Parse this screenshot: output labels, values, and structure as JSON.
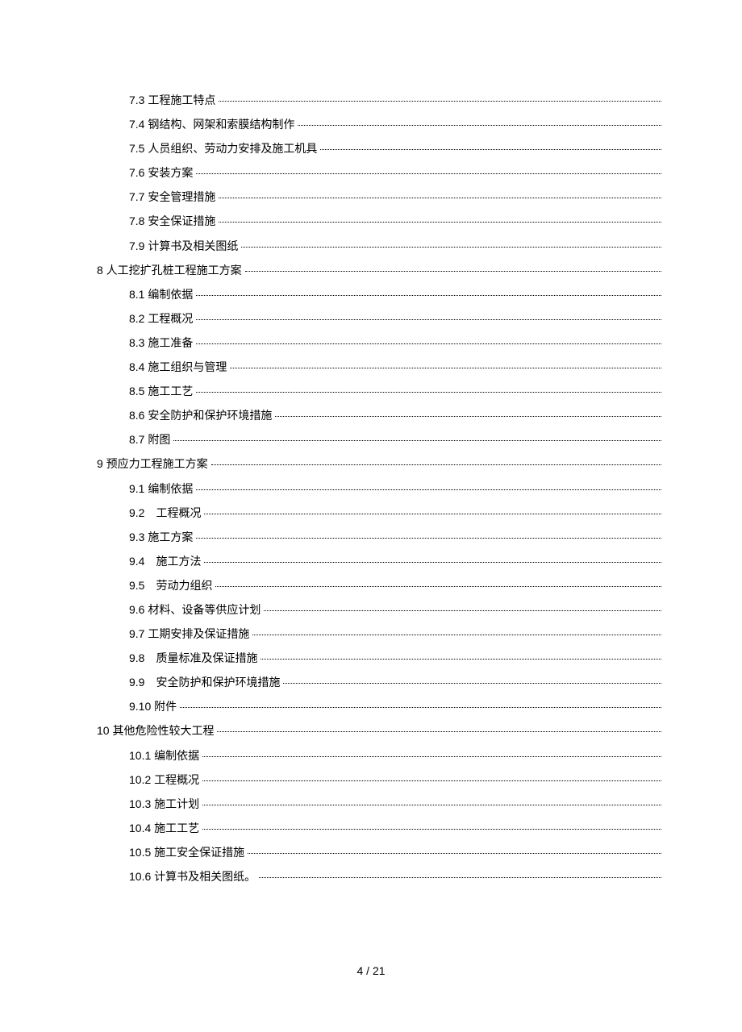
{
  "toc": [
    {
      "level": 2,
      "label": "7.3 工程施工特点"
    },
    {
      "level": 2,
      "label": "7.4 钢结构、网架和索膜结构制作"
    },
    {
      "level": 2,
      "label": "7.5 人员组织、劳动力安排及施工机具"
    },
    {
      "level": 2,
      "label": "7.6 安装方案"
    },
    {
      "level": 2,
      "label": "7.7 安全管理措施"
    },
    {
      "level": 2,
      "label": "7.8 安全保证措施"
    },
    {
      "level": 2,
      "label": "7.9 计算书及相关图纸"
    },
    {
      "level": 1,
      "label": "8 人工挖扩孔桩工程施工方案"
    },
    {
      "level": 2,
      "label": "8.1 编制依据"
    },
    {
      "level": 2,
      "label": "8.2 工程概况"
    },
    {
      "level": 2,
      "label": "8.3 施工准备"
    },
    {
      "level": 2,
      "label": "8.4 施工组织与管理"
    },
    {
      "level": 2,
      "label": "8.5 施工工艺"
    },
    {
      "level": 2,
      "label": "8.6 安全防护和保护环境措施"
    },
    {
      "level": 2,
      "label": "8.7 附图"
    },
    {
      "level": 1,
      "label": "9 预应力工程施工方案"
    },
    {
      "level": 2,
      "label": "9.1 编制依据"
    },
    {
      "level": 2,
      "label": "9.2　工程概况"
    },
    {
      "level": 2,
      "label": "9.3 施工方案"
    },
    {
      "level": 2,
      "label": "9.4　施工方法"
    },
    {
      "level": 2,
      "label": "9.5　劳动力组织"
    },
    {
      "level": 2,
      "label": "9.6 材料、设备等供应计划"
    },
    {
      "level": 2,
      "label": "9.7 工期安排及保证措施"
    },
    {
      "level": 2,
      "label": "9.8　质量标准及保证措施"
    },
    {
      "level": 2,
      "label": "9.9　安全防护和保护环境措施"
    },
    {
      "level": 2,
      "label": "9.10  附件"
    },
    {
      "level": 1,
      "label": "10 其他危险性较大工程"
    },
    {
      "level": 2,
      "label": "10.1 编制依据"
    },
    {
      "level": 2,
      "label": "10.2 工程概况"
    },
    {
      "level": 2,
      "label": "10.3 施工计划"
    },
    {
      "level": 2,
      "label": "10.4 施工工艺"
    },
    {
      "level": 2,
      "label": "10.5 施工安全保证措施"
    },
    {
      "level": 2,
      "label": "10.6 计算书及相关图纸。"
    }
  ],
  "pageNumber": "4 / 21"
}
